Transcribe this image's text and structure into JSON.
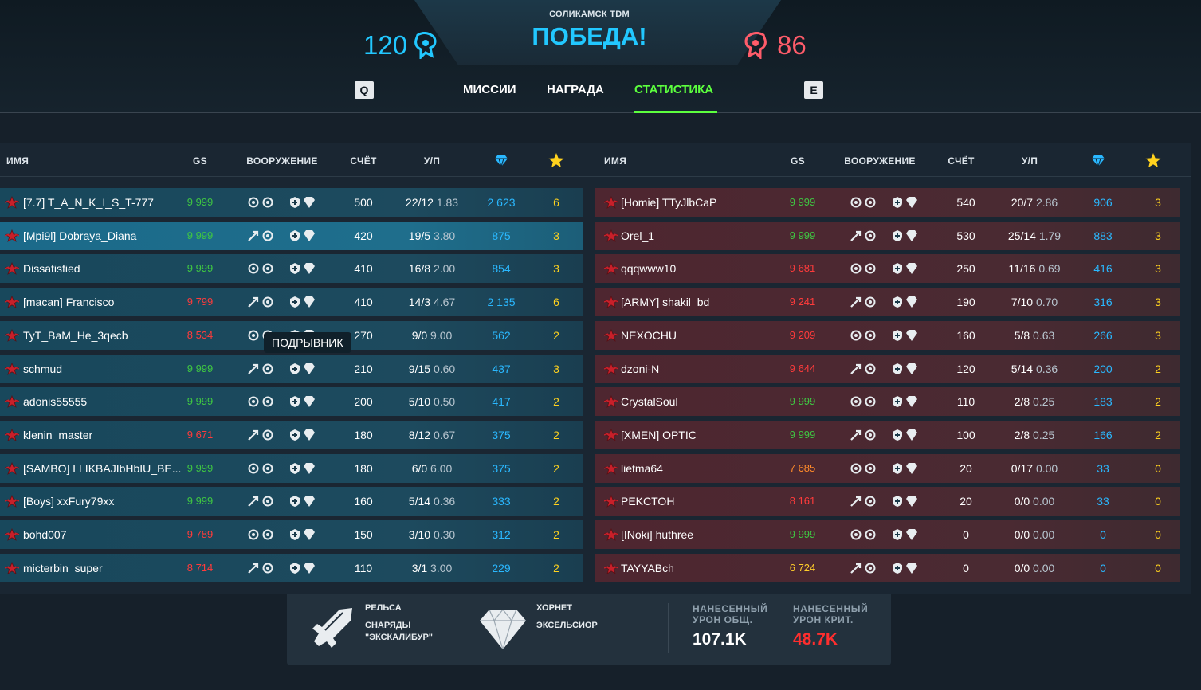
{
  "header": {
    "map_name": "СОЛИКАМСК TDM",
    "result": "ПОБЕДА!",
    "score_left": "120",
    "score_right": "86",
    "key_left": "Q",
    "key_right": "E",
    "tabs": [
      "МИССИИ",
      "НАГРАДА",
      "СТАТИСТИКА"
    ],
    "active_tab": "СТАТИСТИКА"
  },
  "columns": {
    "name": "ИМЯ",
    "gs": "GS",
    "weapons": "ВООРУЖЕНИЕ",
    "score": "СЧЁТ",
    "kd": "У/П",
    "crystals_icon": "crystal-icon",
    "stars_icon": "star-icon"
  },
  "colors": {
    "blue_team": "#22c8ff",
    "red_team": "#ff5c6a",
    "active_tab": "#5cff3e",
    "gs_green": "#3fc742",
    "gs_red": "#ff3b3b",
    "gs_orange": "#ff8a2a",
    "gs_yellow": "#ffcd2a",
    "crystals": "#2ab8ff",
    "stars": "#ffd21e"
  },
  "tooltip": "ПОДРЫВНИК",
  "team_left": [
    {
      "name": "[7.7] T_A_N_K_I_S_T-777",
      "gs": "9 999",
      "gs_color": "green",
      "score": "500",
      "kd": "22/12",
      "ratio": "1.83",
      "crystals": "2 623",
      "stars": "6"
    },
    {
      "name": "[Mpi9l] Dobraya_Diana",
      "gs": "9 999",
      "gs_color": "green",
      "score": "420",
      "kd": "19/5",
      "ratio": "3.80",
      "crystals": "875",
      "stars": "3"
    },
    {
      "name": "Dissatisfied",
      "gs": "9 999",
      "gs_color": "green",
      "score": "410",
      "kd": "16/8",
      "ratio": "2.00",
      "crystals": "854",
      "stars": "3"
    },
    {
      "name": "[macan] Francisco",
      "gs": "9 799",
      "gs_color": "red",
      "score": "410",
      "kd": "14/3",
      "ratio": "4.67",
      "crystals": "2 135",
      "stars": "6"
    },
    {
      "name": "TyT_BaM_He_3qecb",
      "gs": "8 534",
      "gs_color": "red",
      "score": "270",
      "kd": "9/0",
      "ratio": "9.00",
      "crystals": "562",
      "stars": "2"
    },
    {
      "name": "schmud",
      "gs": "9 999",
      "gs_color": "green",
      "score": "210",
      "kd": "9/15",
      "ratio": "0.60",
      "crystals": "437",
      "stars": "3"
    },
    {
      "name": "adonis55555",
      "gs": "9 999",
      "gs_color": "green",
      "score": "200",
      "kd": "5/10",
      "ratio": "0.50",
      "crystals": "417",
      "stars": "2"
    },
    {
      "name": "klenin_master",
      "gs": "9 671",
      "gs_color": "red",
      "score": "180",
      "kd": "8/12",
      "ratio": "0.67",
      "crystals": "375",
      "stars": "2"
    },
    {
      "name": "[SAMBO] LLIKBAJIbHbIU_BE...",
      "gs": "9 999",
      "gs_color": "green",
      "score": "180",
      "kd": "6/0",
      "ratio": "6.00",
      "crystals": "375",
      "stars": "2"
    },
    {
      "name": "[Boys] xxFury79xx",
      "gs": "9 999",
      "gs_color": "green",
      "score": "160",
      "kd": "5/14",
      "ratio": "0.36",
      "crystals": "333",
      "stars": "2"
    },
    {
      "name": "bohd007",
      "gs": "9 789",
      "gs_color": "red",
      "score": "150",
      "kd": "3/10",
      "ratio": "0.30",
      "crystals": "312",
      "stars": "2"
    },
    {
      "name": "micterbin_super",
      "gs": "8 714",
      "gs_color": "red",
      "score": "110",
      "kd": "3/1",
      "ratio": "3.00",
      "crystals": "229",
      "stars": "2"
    }
  ],
  "team_right": [
    {
      "name": "[Homie] TTyJlbCaP",
      "gs": "9 999",
      "gs_color": "green",
      "score": "540",
      "kd": "20/7",
      "ratio": "2.86",
      "crystals": "906",
      "stars": "3"
    },
    {
      "name": "Orel_1",
      "gs": "9 999",
      "gs_color": "green",
      "score": "530",
      "kd": "25/14",
      "ratio": "1.79",
      "crystals": "883",
      "stars": "3"
    },
    {
      "name": "qqqwww10",
      "gs": "9 681",
      "gs_color": "red",
      "score": "250",
      "kd": "11/16",
      "ratio": "0.69",
      "crystals": "416",
      "stars": "3"
    },
    {
      "name": "[ARMY] shakil_bd",
      "gs": "9 241",
      "gs_color": "red",
      "score": "190",
      "kd": "7/10",
      "ratio": "0.70",
      "crystals": "316",
      "stars": "3"
    },
    {
      "name": "NEXOCHU",
      "gs": "9 209",
      "gs_color": "red",
      "score": "160",
      "kd": "5/8",
      "ratio": "0.63",
      "crystals": "266",
      "stars": "3"
    },
    {
      "name": "dzoni-N",
      "gs": "9 644",
      "gs_color": "red",
      "score": "120",
      "kd": "5/14",
      "ratio": "0.36",
      "crystals": "200",
      "stars": "2"
    },
    {
      "name": "CrystalSoul",
      "gs": "9 999",
      "gs_color": "green",
      "score": "110",
      "kd": "2/8",
      "ratio": "0.25",
      "crystals": "183",
      "stars": "2"
    },
    {
      "name": "[XMEN] OPTIC",
      "gs": "9 999",
      "gs_color": "green",
      "score": "100",
      "kd": "2/8",
      "ratio": "0.25",
      "crystals": "166",
      "stars": "2"
    },
    {
      "name": "lietma64",
      "gs": "7 685",
      "gs_color": "orange",
      "score": "20",
      "kd": "0/17",
      "ratio": "0.00",
      "crystals": "33",
      "stars": "0"
    },
    {
      "name": "PEKCTOH",
      "gs": "8 161",
      "gs_color": "red",
      "score": "20",
      "kd": "0/0",
      "ratio": "0.00",
      "crystals": "33",
      "stars": "0"
    },
    {
      "name": "[INoki] huthree",
      "gs": "9 999",
      "gs_color": "green",
      "score": "0",
      "kd": "0/0",
      "ratio": "0.00",
      "crystals": "0",
      "stars": "0"
    },
    {
      "name": "TAYYABch",
      "gs": "6 724",
      "gs_color": "yellow",
      "score": "0",
      "kd": "0/0",
      "ratio": "0.00",
      "crystals": "0",
      "stars": "0"
    }
  ],
  "summary": {
    "weapon_name": "РЕЛЬСА",
    "weapon_ammo_line1": "СНАРЯДЫ",
    "weapon_ammo_line2": "\"ЭКСКАЛИБУР\"",
    "hull_name": "ХОРНЕТ",
    "hull_skin": "ЭКСЕЛЬСИОР",
    "dmg_total_label1": "НАНЕСЕННЫЙ",
    "dmg_total_label2": "УРОН ОБЩ.",
    "dmg_total": "107.1K",
    "dmg_crit_label1": "НАНЕСЕННЫЙ",
    "dmg_crit_label2": "УРОН КРИТ.",
    "dmg_crit": "48.7K"
  }
}
